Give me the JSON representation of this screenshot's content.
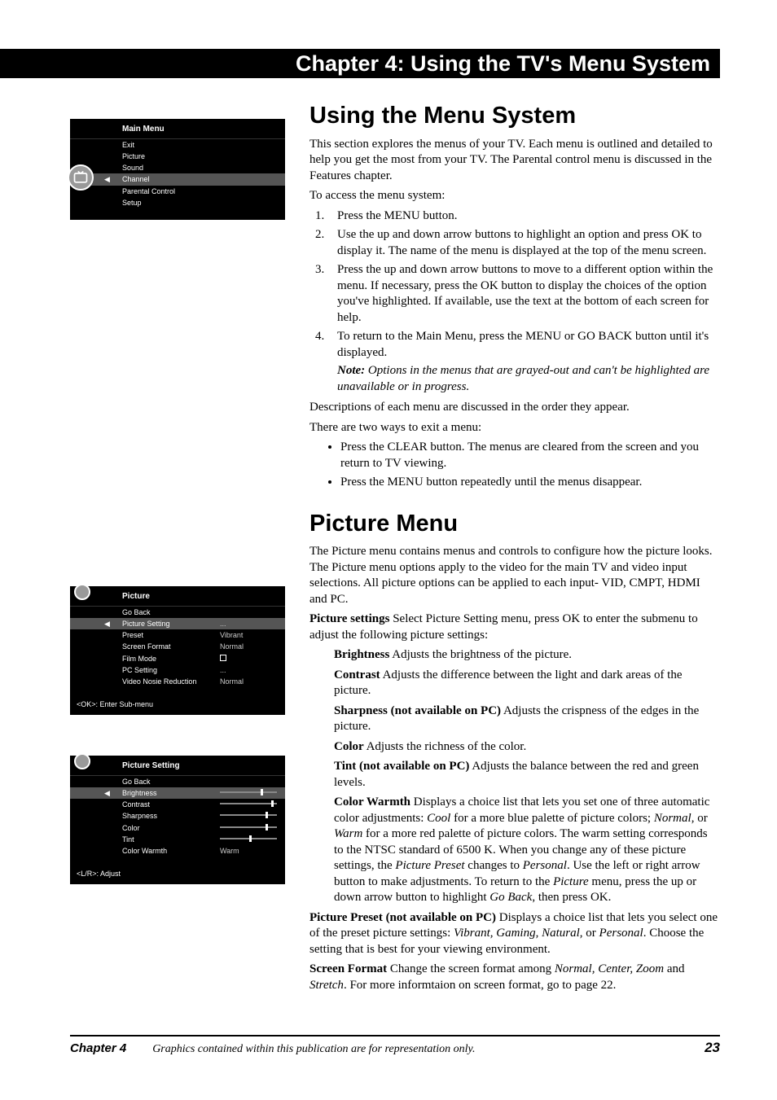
{
  "header": {
    "title": "Chapter 4: Using the TV's Menu System"
  },
  "menu1": {
    "title": "Main Menu",
    "items": [
      "Exit",
      "Picture",
      "Sound",
      "Channel",
      "Parental Control",
      "Setup"
    ],
    "selected_index": 3
  },
  "menu2": {
    "title": "Picture",
    "hint": "<OK>: Enter Sub-menu",
    "rows": [
      {
        "label": "Go Back",
        "value": ""
      },
      {
        "label": "Picture Setting",
        "value": "...",
        "selected": true
      },
      {
        "label": "Preset",
        "value": "Vibrant"
      },
      {
        "label": "Screen Format",
        "value": "Normal"
      },
      {
        "label": "Film Mode",
        "value": "checkbox"
      },
      {
        "label": "PC Setting",
        "value": "..."
      },
      {
        "label": "Video Nosie Reduction",
        "value": "Normal"
      }
    ]
  },
  "menu3": {
    "title": "Picture Setting",
    "hint": "<L/R>: Adjust",
    "rows": [
      {
        "label": "Go Back",
        "value": ""
      },
      {
        "label": "Brightness",
        "value": "slider",
        "pos": 0.75,
        "selected": true
      },
      {
        "label": "Contrast",
        "value": "slider",
        "pos": 0.95
      },
      {
        "label": "Sharpness",
        "value": "slider",
        "pos": 0.85
      },
      {
        "label": "Color",
        "value": "slider",
        "pos": 0.85
      },
      {
        "label": "Tint",
        "value": "slider",
        "pos": 0.55
      },
      {
        "label": "Color Warmth",
        "value": "Warm"
      }
    ]
  },
  "main": {
    "h1": "Using the Menu System",
    "intro": "This section explores the menus of your TV. Each menu is outlined and detailed to help you get the most from your TV. The Parental control menu is discussed in the Features chapter.",
    "access": "To access the menu system:",
    "steps": {
      "s1": "Press the MENU button.",
      "s2": "Use the up and down arrow buttons to highlight an option and press OK to display it. The name of the menu is displayed at the top of the menu screen.",
      "s3": "Press the up and down arrow buttons to move to a different option within the menu. If necessary, press the OK button to display the choices of the option you've highlighted. If available, use the text at the bottom of each screen for help.",
      "s4a": "To return to the Main Menu, press the MENU or GO BACK button until it's displayed.",
      "s4note_label": "Note:",
      "s4note": " Options in the menus that are grayed-out and can't be highlighted are unavailable or in progress."
    },
    "desc1": "Descriptions of each menu are discussed in the order they appear.",
    "desc2": "There are two ways to exit a menu:",
    "bullets": {
      "b1": "Press the CLEAR button. The menus are cleared from the screen and you return to TV viewing.",
      "b2": "Press the MENU button repeatedly until the menus disappear."
    }
  },
  "picture": {
    "h1": "Picture Menu",
    "intro": "The Picture menu contains menus and controls to configure how the picture looks. The Picture menu options apply to the video for the main TV and video input selections. All picture options can be applied to each input- VID, CMPT, HDMI and PC.",
    "ps_term": "Picture settings",
    "ps_body": "   Select Picture Setting menu, press OK to enter the submenu to adjust the following picture settings:",
    "brightness_t": "Brightness",
    "brightness_b": "    Adjusts the brightness of the picture.",
    "contrast_t": "Contrast",
    "contrast_b": "      Adjusts the difference between the light and dark areas of the picture.",
    "sharp_t": "Sharpness (not available on PC)",
    "sharp_b": "    Adjusts the crispness of the edges in the picture.",
    "color_t": "Color",
    "color_b": "    Adjusts the richness of the color.",
    "tint_t": "Tint (not available on PC)",
    "tint_b": "    Adjusts the balance between the red and green levels.",
    "warmth_t": "Color Warmth",
    "warmth_b": "   Displays a choice list that lets you set one of three automatic color adjustments: ",
    "warmth_i1": "Cool",
    "warmth_b2": " for a more blue palette of picture colors; ",
    "warmth_i2": "Normal",
    "warmth_b3": ", or ",
    "warmth_i3": "Warm",
    "warmth_b4": " for a more red palette of picture colors. The warm setting corresponds to the NTSC standard of 6500 K. When you change any of these picture settings, the ",
    "warmth_i4": "Picture Preset",
    "warmth_b5": " changes to ",
    "warmth_i5": "Personal",
    "warmth_b6": ". Use the left or right arrow button to make adjustments. To return to the ",
    "warmth_i6": "Picture",
    "warmth_b7": " menu, press the up or down arrow button to highlight ",
    "warmth_i7": "Go Back",
    "warmth_b8": ", then press OK.",
    "preset_t": "Picture Preset (not available on PC)",
    "preset_b1": "    Displays a choice list that lets you select one of the preset picture settings: ",
    "preset_i1": "Vibrant, Gaming",
    "preset_b2": ", ",
    "preset_i2": "Natural",
    "preset_b3": ", or ",
    "preset_i3": "Personal",
    "preset_b4": ". Choose the setting that is best for your viewing environment.",
    "sf_t": "Screen Format",
    "sf_b1": "    Change the screen format among ",
    "sf_i1": "Normal, Center, Zoom",
    "sf_b2": " and ",
    "sf_i2": "Stretch",
    "sf_b3": ". For more informtaion on screen format, go to page 22."
  },
  "footer": {
    "chapter": "Chapter 4",
    "note": "Graphics contained within this publication are for representation only.",
    "page": "23"
  }
}
